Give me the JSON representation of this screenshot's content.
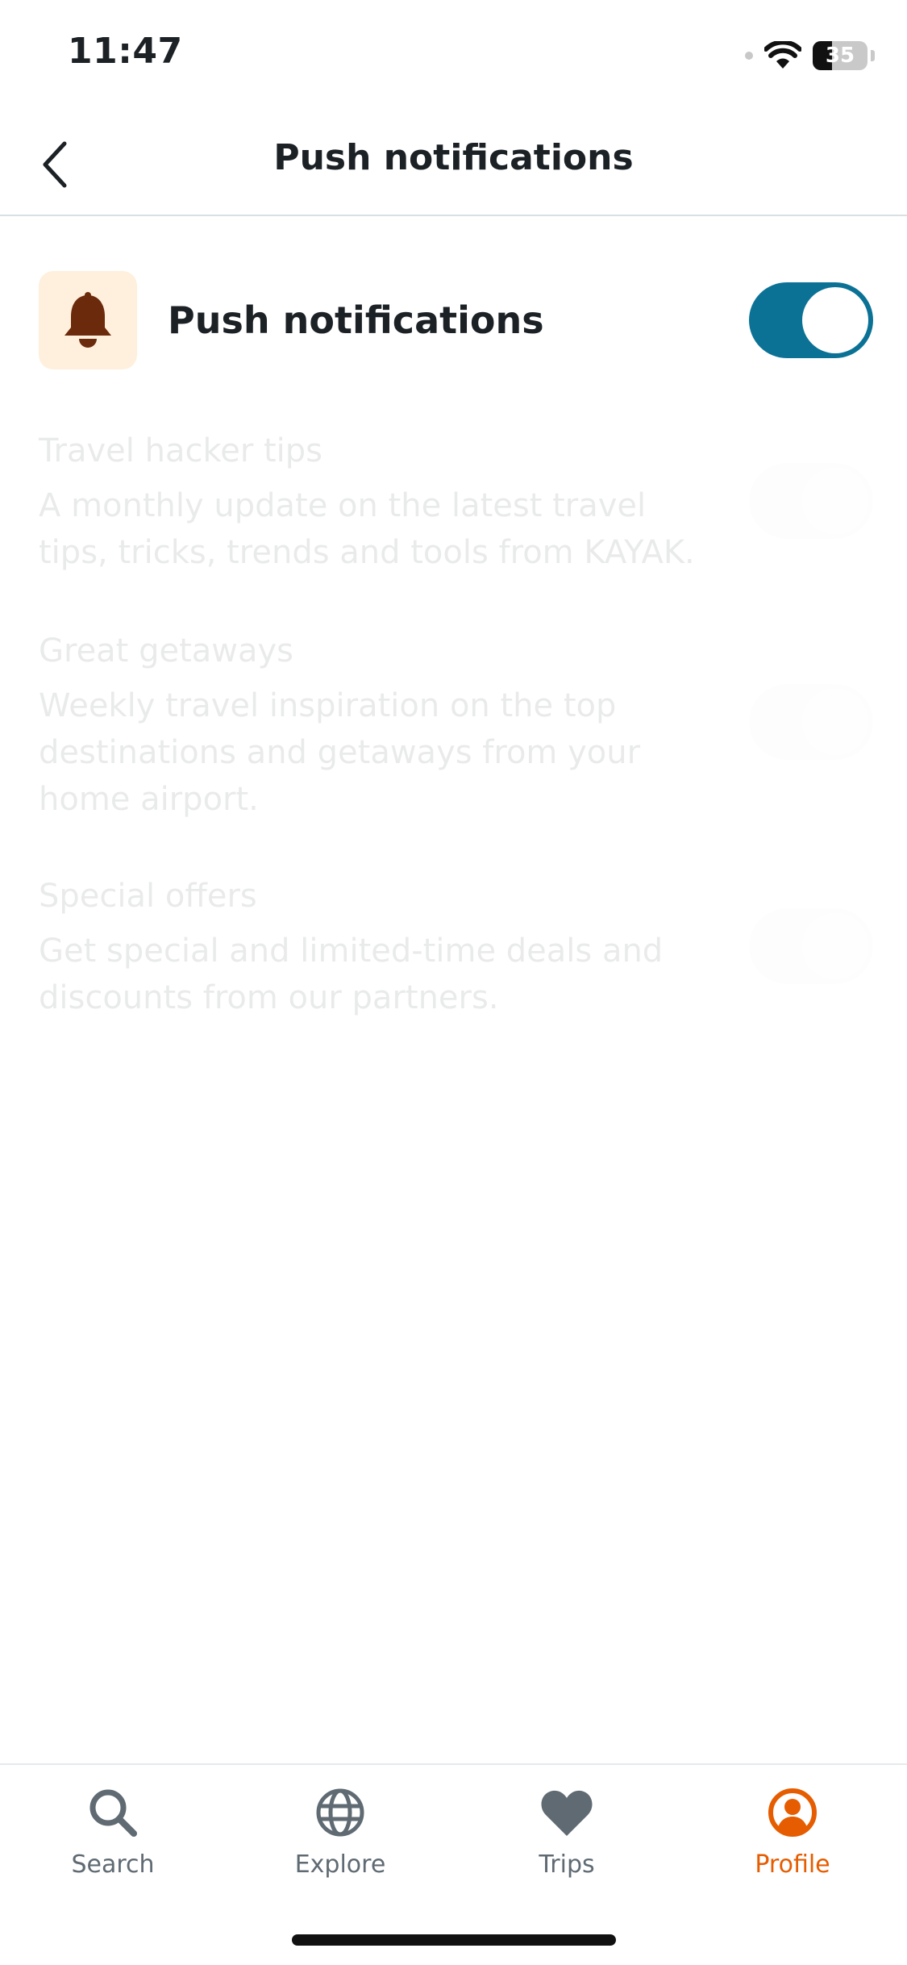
{
  "status_bar": {
    "time": "11:47",
    "battery": "35"
  },
  "header": {
    "title": "Push notifications"
  },
  "master": {
    "label": "Push notifications",
    "enabled": true
  },
  "options": [
    {
      "title": "Travel hacker tips",
      "description": "A monthly update on the latest travel tips, tricks, trends and tools from KAYAK.",
      "enabled": false
    },
    {
      "title": "Great getaways",
      "description": "Weekly travel inspiration on the top destinations and getaways from your home airport.",
      "enabled": false
    },
    {
      "title": "Special offers",
      "description": "Get special and limited-time deals and discounts from our partners.",
      "enabled": false
    }
  ],
  "tabs": [
    {
      "label": "Search",
      "icon": "search-icon"
    },
    {
      "label": "Explore",
      "icon": "globe-icon"
    },
    {
      "label": "Trips",
      "icon": "heart-icon"
    },
    {
      "label": "Profile",
      "icon": "profile-icon"
    }
  ],
  "colors": {
    "toggle_on": "#0b7296",
    "active_tab": "#e65c00",
    "bell_tile": "#fff0dd",
    "bell": "#6b2a0b"
  }
}
